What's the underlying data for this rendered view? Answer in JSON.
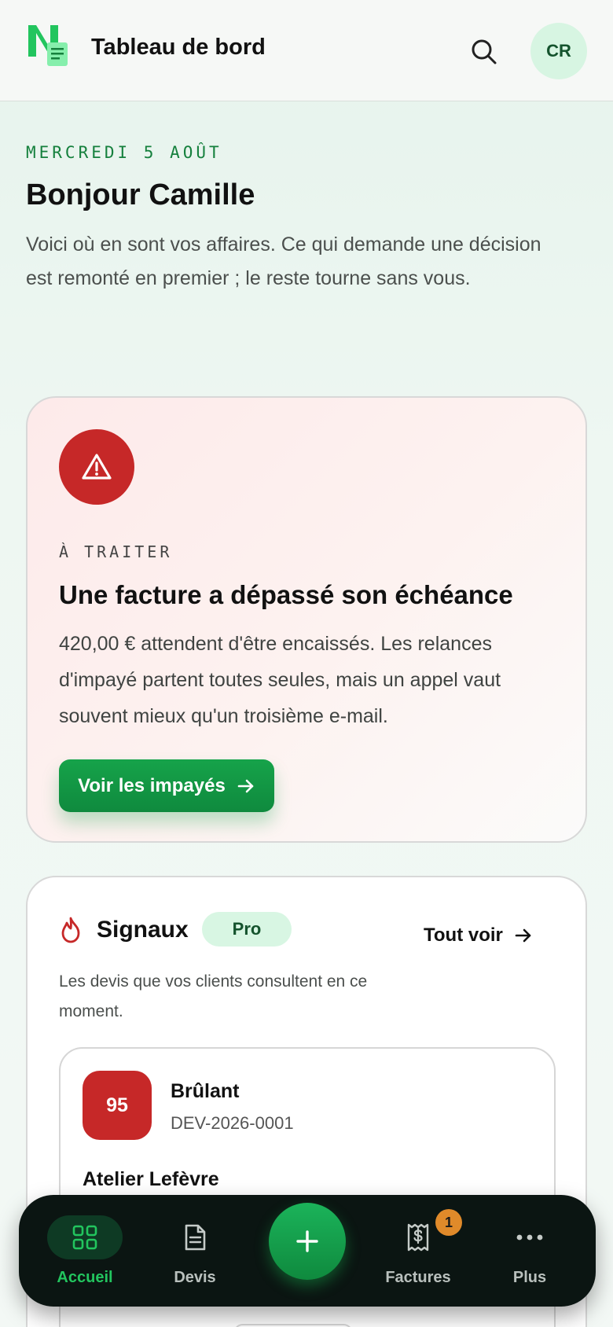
{
  "header": {
    "title": "Tableau de bord",
    "avatar_initials": "CR"
  },
  "greeting": {
    "date": "MERCREDI 5 AOÛT",
    "title": "Bonjour Camille",
    "intro": "Voici où en sont vos affaires. Ce qui demande une décision est remonté en premier ; le reste tourne sans vous."
  },
  "alert": {
    "eyebrow": "À TRAITER",
    "title": "Une facture a dépassé son échéance",
    "body": "420,00 € attendent d'être encaissés. Les relances d'impayé partent toutes seules, mais un appel vaut souvent mieux qu'un troisième e-mail.",
    "button_label": "Voir les impayés",
    "icon": "warning-icon",
    "accent_color": "#c62828"
  },
  "signals": {
    "title": "Signaux",
    "badge": "Pro",
    "see_all_label": "Tout voir",
    "subtitle": "Les devis que vos clients consultent en ce moment.",
    "items": [
      {
        "score": "95",
        "heat": "Brûlant",
        "reference": "DEV-2026-0001",
        "client": "Atelier Lefèvre"
      }
    ]
  },
  "nav": {
    "items": [
      {
        "label": "Accueil",
        "icon": "grid-icon",
        "active": true
      },
      {
        "label": "Devis",
        "icon": "document-icon",
        "active": false
      },
      {
        "label": "Factures",
        "icon": "receipt-icon",
        "active": false,
        "badge": "1"
      },
      {
        "label": "Plus",
        "icon": "more-icon",
        "active": false
      }
    ],
    "fab_icon": "plus-icon"
  },
  "colors": {
    "brand_green": "#16a34a",
    "danger_red": "#c62828",
    "nav_background": "#0b1512",
    "badge_orange": "#e08a2a"
  }
}
